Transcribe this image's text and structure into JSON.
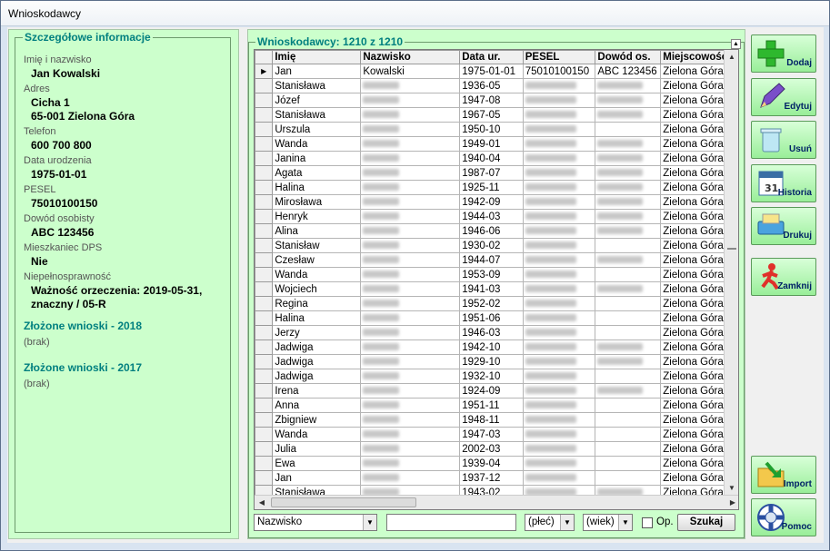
{
  "window": {
    "title": "Wnioskodawcy"
  },
  "details": {
    "legend": "Szczegółowe informacje",
    "fields": [
      {
        "label": "Imię i nazwisko",
        "value": [
          "Jan Kowalski"
        ]
      },
      {
        "label": "Adres",
        "value": [
          "Cicha 1",
          "65-001 Zielona Góra"
        ]
      },
      {
        "label": "Telefon",
        "value": [
          "600 700 800"
        ]
      },
      {
        "label": "Data urodzenia",
        "value": [
          "1975-01-01"
        ]
      },
      {
        "label": "PESEL",
        "value": [
          "75010100150"
        ]
      },
      {
        "label": "Dowód osobisty",
        "value": [
          "ABC 123456"
        ]
      },
      {
        "label": "Mieszkaniec DPS",
        "value": [
          "Nie"
        ]
      },
      {
        "label": "Niepełnosprawność",
        "value": [
          "Ważność orzeczenia: 2019-05-31,",
          "znaczny / 05-R"
        ]
      }
    ],
    "sections": [
      {
        "title": "Złożone wnioski - 2018",
        "content": "(brak)"
      },
      {
        "title": "Złożone wnioski - 2017",
        "content": "(brak)"
      }
    ]
  },
  "list": {
    "legend": "Wnioskodawcy: 1210 z 1210",
    "collapse_icon": "chevron-up",
    "columns": [
      "Imię",
      "Nazwisko",
      "Data ur.",
      "PESEL",
      "Dowód os.",
      "Miejscowość"
    ],
    "rows": [
      [
        "Jan",
        "Kowalski",
        "1975-01-01",
        "75010100150",
        "ABC 123456",
        "Zielona Góra"
      ],
      [
        "Stanisława",
        "",
        "1936-05",
        "",
        "",
        "Zielona Góra"
      ],
      [
        "Józef",
        "",
        "1947-08",
        "",
        "",
        "Zielona Góra"
      ],
      [
        "Stanisława",
        "",
        "1967-05",
        "",
        "",
        "Zielona Góra"
      ],
      [
        "Urszula",
        "",
        "1950-10",
        "",
        "",
        "Zielona Góra"
      ],
      [
        "Wanda",
        "",
        "1949-01",
        "",
        "",
        "Zielona Góra"
      ],
      [
        "Janina",
        "",
        "1940-04",
        "",
        "",
        "Zielona Góra"
      ],
      [
        "Agata",
        "",
        "1987-07",
        "",
        "",
        "Zielona Góra"
      ],
      [
        "Halina",
        "",
        "1925-11",
        "",
        "",
        "Zielona Góra"
      ],
      [
        "Mirosława",
        "",
        "1942-09",
        "",
        "",
        "Zielona Góra"
      ],
      [
        "Henryk",
        "",
        "1944-03",
        "",
        "",
        "Zielona Góra"
      ],
      [
        "Alina",
        "",
        "1946-06",
        "",
        "",
        "Zielona Góra"
      ],
      [
        "Stanisław",
        "",
        "1930-02",
        "",
        "",
        "Zielona Góra"
      ],
      [
        "Czesław",
        "",
        "1944-07",
        "",
        "",
        "Zielona Góra"
      ],
      [
        "Wanda",
        "",
        "1953-09",
        "",
        "",
        "Zielona Góra"
      ],
      [
        "Wojciech",
        "",
        "1941-03",
        "",
        "",
        "Zielona Góra"
      ],
      [
        "Regina",
        "",
        "1952-02",
        "",
        "",
        "Zielona Góra"
      ],
      [
        "Halina",
        "",
        "1951-06",
        "",
        "",
        "Zielona Góra"
      ],
      [
        "Jerzy",
        "",
        "1946-03",
        "",
        "",
        "Zielona Góra"
      ],
      [
        "Jadwiga",
        "",
        "1942-10",
        "",
        "",
        "Zielona Góra"
      ],
      [
        "Jadwiga",
        "",
        "1929-10",
        "",
        "",
        "Zielona Góra"
      ],
      [
        "Jadwiga",
        "",
        "1932-10",
        "",
        "",
        "Zielona Góra"
      ],
      [
        "Irena",
        "",
        "1924-09",
        "",
        "",
        "Zielona Góra"
      ],
      [
        "Anna",
        "",
        "1951-11",
        "",
        "",
        "Zielona Góra"
      ],
      [
        "Zbigniew",
        "",
        "1948-11",
        "",
        "",
        "Zielona Góra"
      ],
      [
        "Wanda",
        "",
        "1947-03",
        "",
        "",
        "Zielona Góra"
      ],
      [
        "Julia",
        "",
        "2002-03",
        "",
        "",
        "Zielona Góra"
      ],
      [
        "Ewa",
        "",
        "1939-04",
        "",
        "",
        "Zielona Góra"
      ],
      [
        "Jan",
        "",
        "1937-12",
        "",
        "",
        "Zielona Góra"
      ],
      [
        "Stanisława",
        "",
        "1943-02",
        "",
        "",
        "Zielona Góra"
      ]
    ],
    "empty_cols_per_row": [
      [],
      [
        1,
        3,
        4
      ],
      [
        1,
        3,
        4
      ],
      [
        1,
        3,
        4
      ],
      [
        1,
        3
      ],
      [
        1,
        3,
        4
      ],
      [
        1,
        3,
        4
      ],
      [
        1,
        3,
        4
      ],
      [
        1,
        3,
        4
      ],
      [
        1,
        3,
        4
      ],
      [
        1,
        3,
        4
      ],
      [
        1,
        3,
        4
      ],
      [
        1,
        3
      ],
      [
        1,
        3,
        4
      ],
      [
        1,
        3
      ],
      [
        1,
        3,
        4
      ],
      [
        1,
        3
      ],
      [
        1,
        3
      ],
      [
        1,
        3
      ],
      [
        1,
        3,
        4
      ],
      [
        1,
        3,
        4
      ],
      [
        1,
        3
      ],
      [
        1,
        3,
        4
      ],
      [
        1,
        3
      ],
      [
        1,
        3
      ],
      [
        1,
        3
      ],
      [
        1,
        3
      ],
      [
        1,
        3
      ],
      [
        1,
        3
      ],
      [
        1,
        3,
        4
      ]
    ]
  },
  "search": {
    "field_select": "Nazwisko",
    "text_value": "",
    "gender_select": "(płeć)",
    "age_select": "(wiek)",
    "op_label": "Op.",
    "op_checked": false,
    "search_button": "Szukaj"
  },
  "toolbar": [
    {
      "label": "Dodaj",
      "icon": "plus-icon"
    },
    {
      "label": "Edytuj",
      "icon": "pencil-icon"
    },
    {
      "label": "Usuń",
      "icon": "trash-icon"
    },
    {
      "label": "Historia",
      "icon": "calendar-icon"
    },
    {
      "label": "Drukuj",
      "icon": "printer-icon"
    },
    {
      "label": "Zamknij",
      "icon": "running-man-icon"
    },
    {
      "label": "Import",
      "icon": "folder-import-icon"
    },
    {
      "label": "Pomoc",
      "icon": "lifebuoy-icon"
    }
  ],
  "colors": {
    "panel": "#ccffcc",
    "accent": "#007f7f",
    "button_label": "#002266"
  }
}
